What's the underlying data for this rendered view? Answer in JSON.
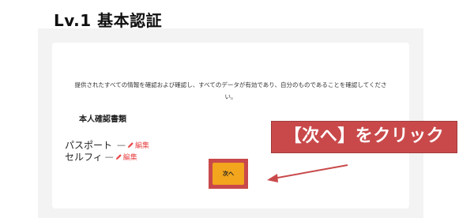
{
  "page": {
    "title": "Lv.1 基本認証"
  },
  "verification": {
    "description": "提供されたすべての情報を確認および確認し、すべてのデータが有効であり、自分のものであることを確認してください。",
    "section_heading": "本人確認書類",
    "documents": [
      {
        "name": "パスポート",
        "status": "—",
        "edit_label": "編集"
      },
      {
        "name": "セルフィ",
        "status": "—",
        "edit_label": "編集"
      }
    ],
    "next_button_label": "次へ"
  },
  "annotation": {
    "callout_text": "【次へ】をクリック",
    "highlight_color": "#c9494b"
  },
  "colors": {
    "accent_button": "#f2a51d",
    "edit_link": "#e8484a"
  },
  "icons": {
    "edit": "pencil-icon",
    "pointer": "arrow-icon"
  }
}
